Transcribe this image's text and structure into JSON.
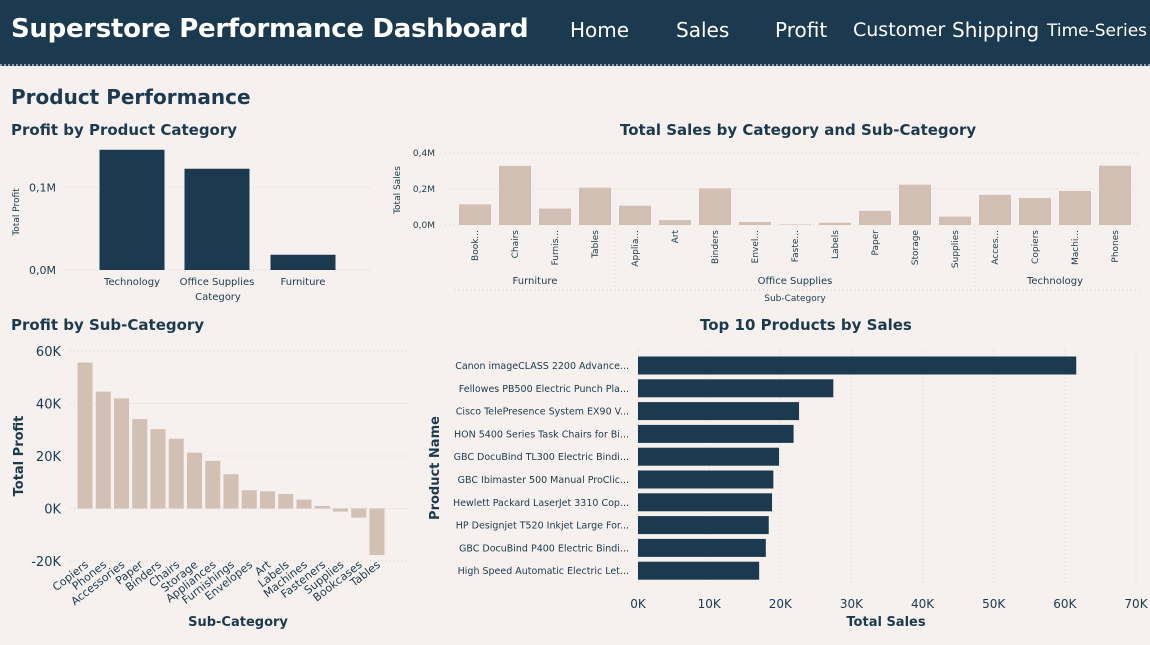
{
  "header": {
    "title": "Superstore Performance Dashboard",
    "nav": [
      "Home",
      "Sales",
      "Profit",
      "Customer",
      "Shipping",
      "Time-Series"
    ]
  },
  "section_title": "Product Performance",
  "colors": {
    "dark": "#1b3a4f",
    "tan": "#d3c0b4",
    "background": "#f6f1ee",
    "grid": "#d9d0ca"
  },
  "chart_data": [
    {
      "type": "bar",
      "title": "Profit by Product Category",
      "xlabel": "Category",
      "ylabel": "Total Profit",
      "categories": [
        "Technology",
        "Office Supplies",
        "Furniture"
      ],
      "values": [
        145455,
        122491,
        18451
      ],
      "ylim": [
        0,
        150000
      ],
      "yticks": [
        0,
        100000
      ],
      "ytick_labels": [
        "0,0M",
        "0,1M"
      ],
      "color": "#1b3a4f"
    },
    {
      "type": "bar",
      "title": "Total Sales by Category and Sub-Category",
      "xlabel": "Sub-Category",
      "ylabel": "Total Sales",
      "groups": [
        {
          "name": "Furniture",
          "categories": [
            "Book...",
            "Chairs",
            "Furnis...",
            "Tables"
          ],
          "values": [
            114880,
            328449,
            91705,
            206966
          ]
        },
        {
          "name": "Office Supplies",
          "categories": [
            "Applia...",
            "Art",
            "Binders",
            "Envel...",
            "Faste...",
            "Labels",
            "Paper",
            "Storage",
            "Supplies"
          ],
          "values": [
            107532,
            27119,
            203413,
            16476,
            3024,
            12486,
            78479,
            223844,
            46674
          ]
        },
        {
          "name": "Technology",
          "categories": [
            "Acces...",
            "Copiers",
            "Machi...",
            "Phones"
          ],
          "values": [
            167380,
            149528,
            189239,
            330007
          ]
        }
      ],
      "ylim": [
        0,
        400000
      ],
      "yticks": [
        0,
        200000,
        400000
      ],
      "ytick_labels": [
        "0,0M",
        "0,2M",
        "0,4M"
      ],
      "color": "#d3c0b4"
    },
    {
      "type": "bar",
      "title": "Profit by Sub-Category",
      "xlabel": "Sub-Category",
      "ylabel": "Total Profit",
      "categories": [
        "Copiers",
        "Phones",
        "Accessories",
        "Paper",
        "Binders",
        "Chairs",
        "Storage",
        "Appliances",
        "Furnishings",
        "Envelopes",
        "Art",
        "Labels",
        "Machines",
        "Fasteners",
        "Supplies",
        "Bookcases",
        "Tables"
      ],
      "values": [
        55618,
        44516,
        41937,
        34054,
        30222,
        26590,
        21279,
        18138,
        13059,
        6964,
        6528,
        5546,
        3385,
        950,
        -1189,
        -3473,
        -17725
      ],
      "ylim": [
        -20000,
        60000
      ],
      "yticks": [
        -20000,
        0,
        20000,
        40000,
        60000
      ],
      "ytick_labels": [
        "-20K",
        "0K",
        "20K",
        "40K",
        "60K"
      ],
      "color": "#d3c0b4"
    },
    {
      "type": "bar",
      "orientation": "horizontal",
      "title": "Top 10 Products by Sales",
      "xlabel": "Total Sales",
      "ylabel": "Product Name",
      "categories": [
        "Canon imageCLASS 2200 Advance...",
        "Fellowes PB500 Electric Punch Pla...",
        "Cisco TelePresence System EX90 V...",
        "HON 5400 Series Task Chairs for Bi...",
        "GBC DocuBind TL300 Electric Bindi...",
        "GBC Ibimaster 500 Manual ProClic...",
        "Hewlett Packard LaserJet 3310 Cop...",
        "HP Designjet T520 Inkjet Large For...",
        "GBC DocuBind P400 Electric Bindi...",
        "High Speed Automatic Electric Let..."
      ],
      "values": [
        61600,
        27453,
        22638,
        21870,
        19823,
        19024,
        18840,
        18375,
        17965,
        17030
      ],
      "xlim": [
        0,
        70000
      ],
      "xticks": [
        0,
        10000,
        20000,
        30000,
        40000,
        50000,
        60000,
        70000
      ],
      "xtick_labels": [
        "0K",
        "10K",
        "20K",
        "30K",
        "40K",
        "50K",
        "60K",
        "70K"
      ],
      "color": "#1b3a4f"
    }
  ]
}
